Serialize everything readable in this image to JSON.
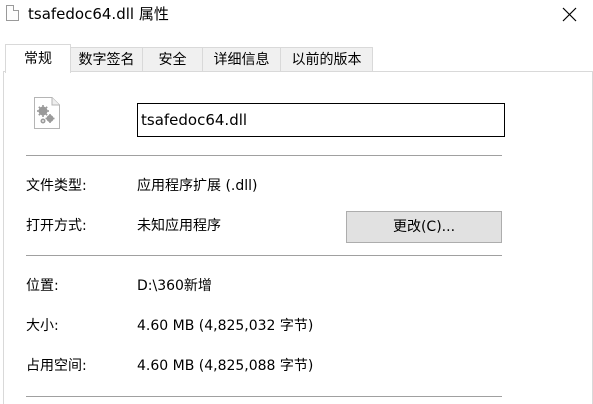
{
  "window": {
    "title": "tsafedoc64.dll 属性"
  },
  "tabs": [
    {
      "label": "常规",
      "active": true
    },
    {
      "label": "数字签名",
      "active": false
    },
    {
      "label": "安全",
      "active": false
    },
    {
      "label": "详细信息",
      "active": false
    },
    {
      "label": "以前的版本",
      "active": false
    }
  ],
  "general": {
    "file_name": "tsafedoc64.dll",
    "type_label": "文件类型:",
    "type_value": "应用程序扩展 (.dll)",
    "opens_with_label": "打开方式:",
    "opens_with_value": "未知应用程序",
    "change_button": "更改(C)...",
    "location_label": "位置:",
    "location_value": "D:\\360新增",
    "size_label": "大小:",
    "size_value": "4.60 MB (4,825,032 字节)",
    "size_on_disk_label": "占用空间:",
    "size_on_disk_value": "4.60 MB (4,825,088 字节)"
  },
  "icons": {
    "title": "dll-file-icon",
    "file": "dll-gear-file-icon",
    "close": "close-icon"
  }
}
